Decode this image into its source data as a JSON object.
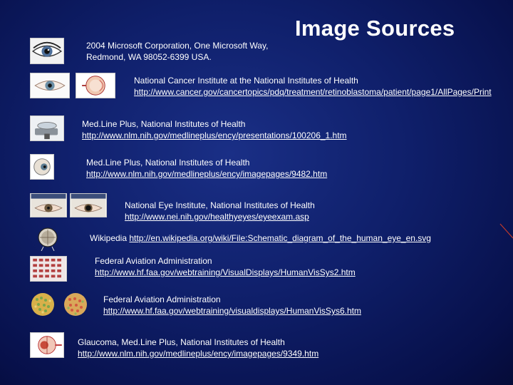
{
  "title": "Image Sources",
  "sources": [
    {
      "text_line1": "2004 Microsoft Corporation, One Microsoft Way,",
      "text_line2": "Redmond, WA 98052-6399 USA.",
      "icon": "eye-photo-icon"
    },
    {
      "text": "National Cancer Institute at the National Institutes of Health",
      "url": "http://www.cancer.gov/cancertopics/pdq/treatment/retinoblastoma/patient/page1/AllPages/Print",
      "icon": "eye-anatomy-icon"
    },
    {
      "text": "Med.Line Plus, National Institutes of Health",
      "url": "http://www.nlm.nih.gov/medlineplus/ency/presentations/100206_1.htm",
      "icon": "eye-exam-device-icon"
    },
    {
      "text": "Med.Line Plus, National Institutes of Health",
      "url": "http://www.nlm.nih.gov/medlineplus/ency/imagepages/9482.htm",
      "icon": "eyeball-diagram-icon"
    },
    {
      "text": "National Eye Institute, National Institutes of Health",
      "url": "http://www.nei.nih.gov/healthyeyes/eyeexam.asp",
      "icon": "pupil-comparison-icon"
    },
    {
      "text": "Wikipedia",
      "url": "http://en.wikipedia.org/wiki/File:Schematic_diagram_of_the_human_eye_en.svg",
      "icon": "eye-schematic-icon"
    },
    {
      "text": "Federal Aviation Administration",
      "url": "http://www.hf.faa.gov/webtraining/VisualDisplays/HumanVisSys2.htm",
      "icon": "visual-display-icon"
    },
    {
      "text": "Federal Aviation Administration",
      "url": "http://www.hf.faa.gov/webtraining/visualdisplays/HumanVisSys6.htm",
      "icon": "color-blindness-test-icon"
    },
    {
      "text": "Glaucoma, Med.Line Plus, National Institutes of Health",
      "url": "http://www.nlm.nih.gov/medlineplus/ency/imagepages/9349.htm",
      "icon": "glaucoma-eye-icon"
    }
  ],
  "pupil_labels": [
    "",
    ""
  ]
}
